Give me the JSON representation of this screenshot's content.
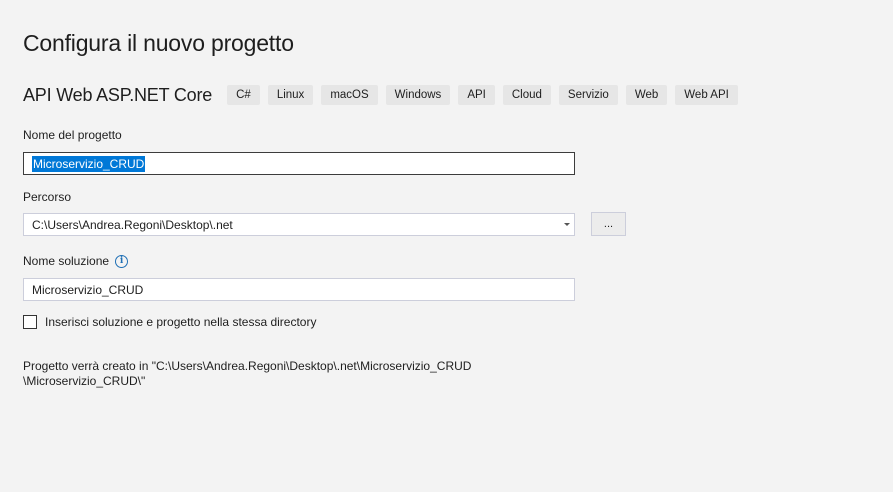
{
  "page": {
    "title": "Configura il nuovo progetto"
  },
  "template": {
    "name": "API Web ASP.NET Core",
    "tags": [
      "C#",
      "Linux",
      "macOS",
      "Windows",
      "API",
      "Cloud",
      "Servizio",
      "Web",
      "Web API"
    ]
  },
  "project_name": {
    "label": "Nome del progetto",
    "value": "Microservizio_CRUD"
  },
  "location": {
    "label": "Percorso",
    "value": "C:\\Users\\Andrea.Regoni\\Desktop\\.net",
    "browse_label": "..."
  },
  "solution_name": {
    "label": "Nome soluzione",
    "info_glyph": "i",
    "value": "Microservizio_CRUD"
  },
  "same_directory": {
    "label": "Inserisci soluzione e progetto nella stessa directory",
    "checked": false
  },
  "info": {
    "line1": "Progetto verrà creato in \"C:\\Users\\Andrea.Regoni\\Desktop\\.net\\Microservizio_CRUD",
    "line2": "\\Microservizio_CRUD\\\""
  },
  "colors": {
    "background": "#f3f3f3",
    "selection": "#0078d7",
    "info_icon": "#1f6fb5",
    "tag_background": "#e6e6e6"
  }
}
